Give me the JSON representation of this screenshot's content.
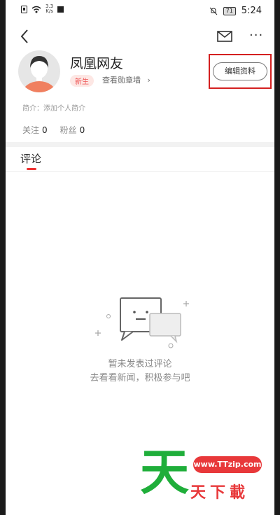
{
  "status_bar": {
    "speed_value": "3.3",
    "speed_unit": "K/s",
    "battery": "71",
    "time": "5:24"
  },
  "profile": {
    "username": "凤凰网友",
    "badge": "新生",
    "medal_link": "查看勋章墙",
    "edit_button": "编辑资料",
    "bio": "简介：添加个人简介",
    "follow_label": "关注",
    "follow_count": "0",
    "fans_label": "粉丝",
    "fans_count": "0"
  },
  "tabs": {
    "comments": "评论"
  },
  "empty_state": {
    "line1": "暂未发表过评论",
    "line2": "去看看新闻，积极参与吧"
  },
  "watermark": {
    "char": "天",
    "url": "www.TTzip.com",
    "text": "天下載"
  },
  "colors": {
    "accent": "#e33333",
    "highlight_box": "#d42020",
    "watermark_green": "#1fae3a",
    "watermark_red": "#e8383a"
  }
}
